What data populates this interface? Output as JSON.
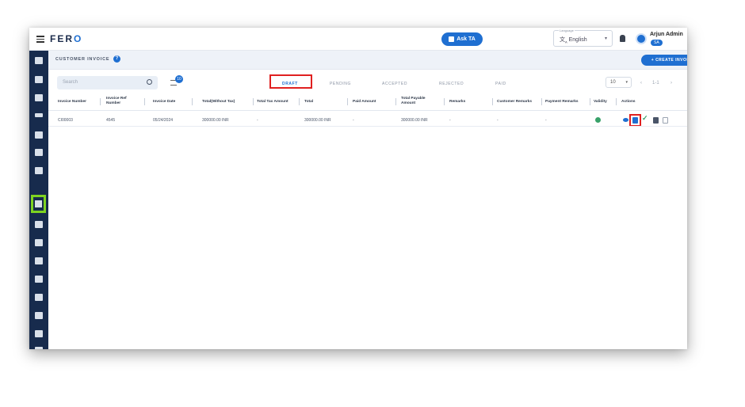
{
  "app": {
    "logo_prefix": "FER",
    "logo_accent": "O"
  },
  "topbar": {
    "ask_label": "Ask TA",
    "language_caption": "Language",
    "language_value": "English",
    "user_name": "Arjun Admin",
    "user_role": "SA"
  },
  "page": {
    "title": "CUSTOMER INVOICE",
    "info_glyph": "?",
    "create_label": "+ CREATE INVOICE"
  },
  "search": {
    "placeholder": "Search"
  },
  "filter": {
    "badge": "10"
  },
  "tabs": [
    "DRAFT",
    "PENDING",
    "ACCEPTED",
    "REJECTED",
    "PAID"
  ],
  "active_tab": "DRAFT",
  "pagination": {
    "per_page": "10",
    "range": "1-1"
  },
  "table": {
    "headers": [
      "Invoice Number",
      "Invoice Ref Number",
      "Invoice Date",
      "Total(Without Tax)",
      "Total Tax Amount",
      "Total",
      "Paid Amount",
      "Total Payable Amount",
      "Remarks",
      "Customer Remarks",
      "Payment Remarks",
      "Validity",
      "Actions"
    ],
    "rows": [
      {
        "invoice_number": "CI00003",
        "ref_number": "4545",
        "date": "05/24/2024",
        "total_wo_tax": "300000.00 INR",
        "tax": "-",
        "total": "300000.00 INR",
        "paid": "-",
        "payable": "300000.00 INR",
        "remarks": "-",
        "customer_remarks": "-",
        "payment_remarks": "-"
      }
    ]
  },
  "colors": {
    "primary": "#1f6fd1",
    "sidebar": "#172b4d",
    "highlight_red": "#e02020",
    "highlight_green": "#7ed321",
    "valid_green": "#38a169"
  },
  "icons": [
    "menu-icon",
    "bell-icon",
    "user-icon",
    "search-icon",
    "filter-icon",
    "view-icon",
    "document-icon",
    "approve-check-icon",
    "calculator-icon",
    "duplicate-icon"
  ]
}
